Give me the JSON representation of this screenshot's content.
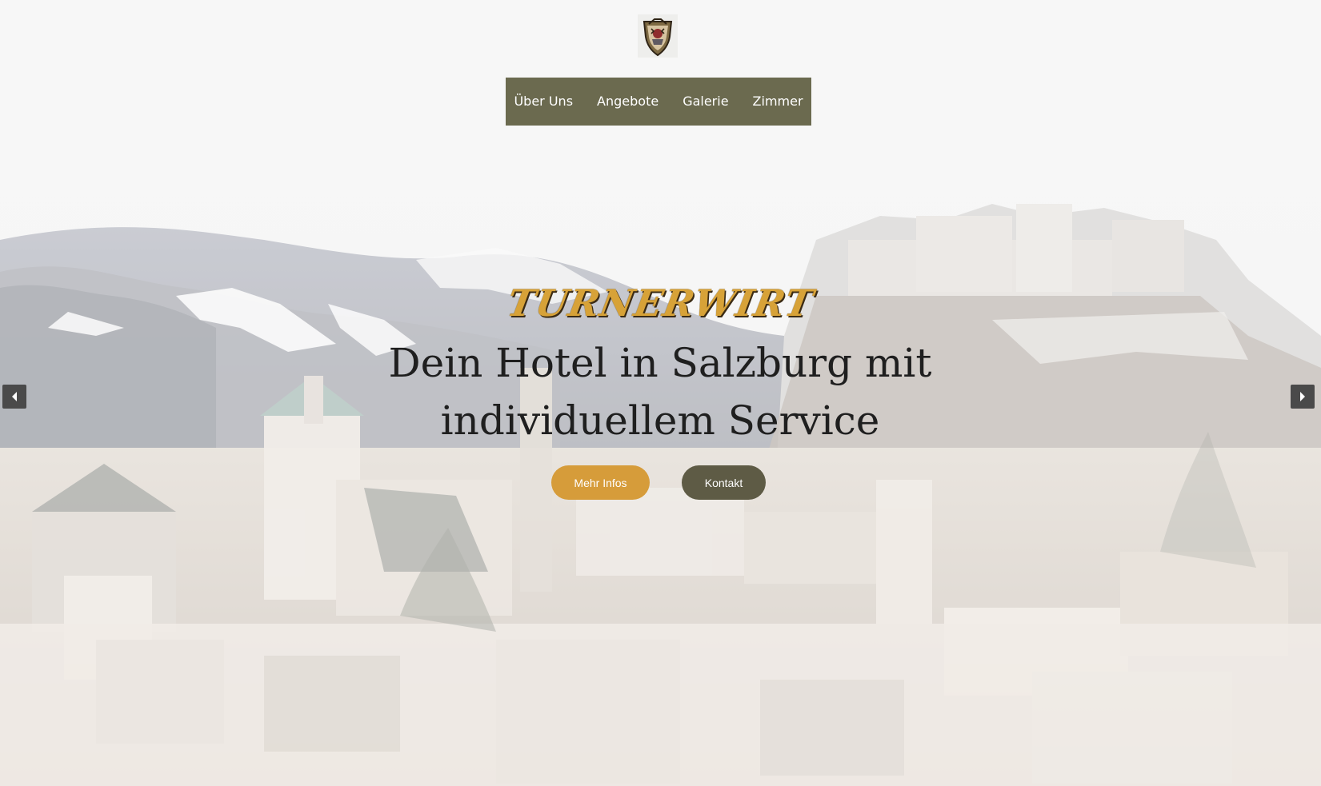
{
  "site": {
    "brand": "TURNERWIRT",
    "headline": "Dein Hotel in Salzburg mit individuellem Service"
  },
  "nav": {
    "items": [
      {
        "label": "Über Uns"
      },
      {
        "label": "Angebote"
      },
      {
        "label": "Galerie"
      },
      {
        "label": "Zimmer"
      }
    ]
  },
  "hero": {
    "buttons": {
      "more": "Mehr Infos",
      "contact": "Kontakt"
    }
  },
  "icons": {
    "logo": "coat-of-arms-icon",
    "prev": "chevron-left-icon",
    "next": "chevron-right-icon"
  },
  "colors": {
    "nav_bg": "#6b6a4f",
    "accent_gold": "#d69c3a",
    "button_dark": "#5e5b45",
    "text_dark": "#1f1f1f"
  }
}
